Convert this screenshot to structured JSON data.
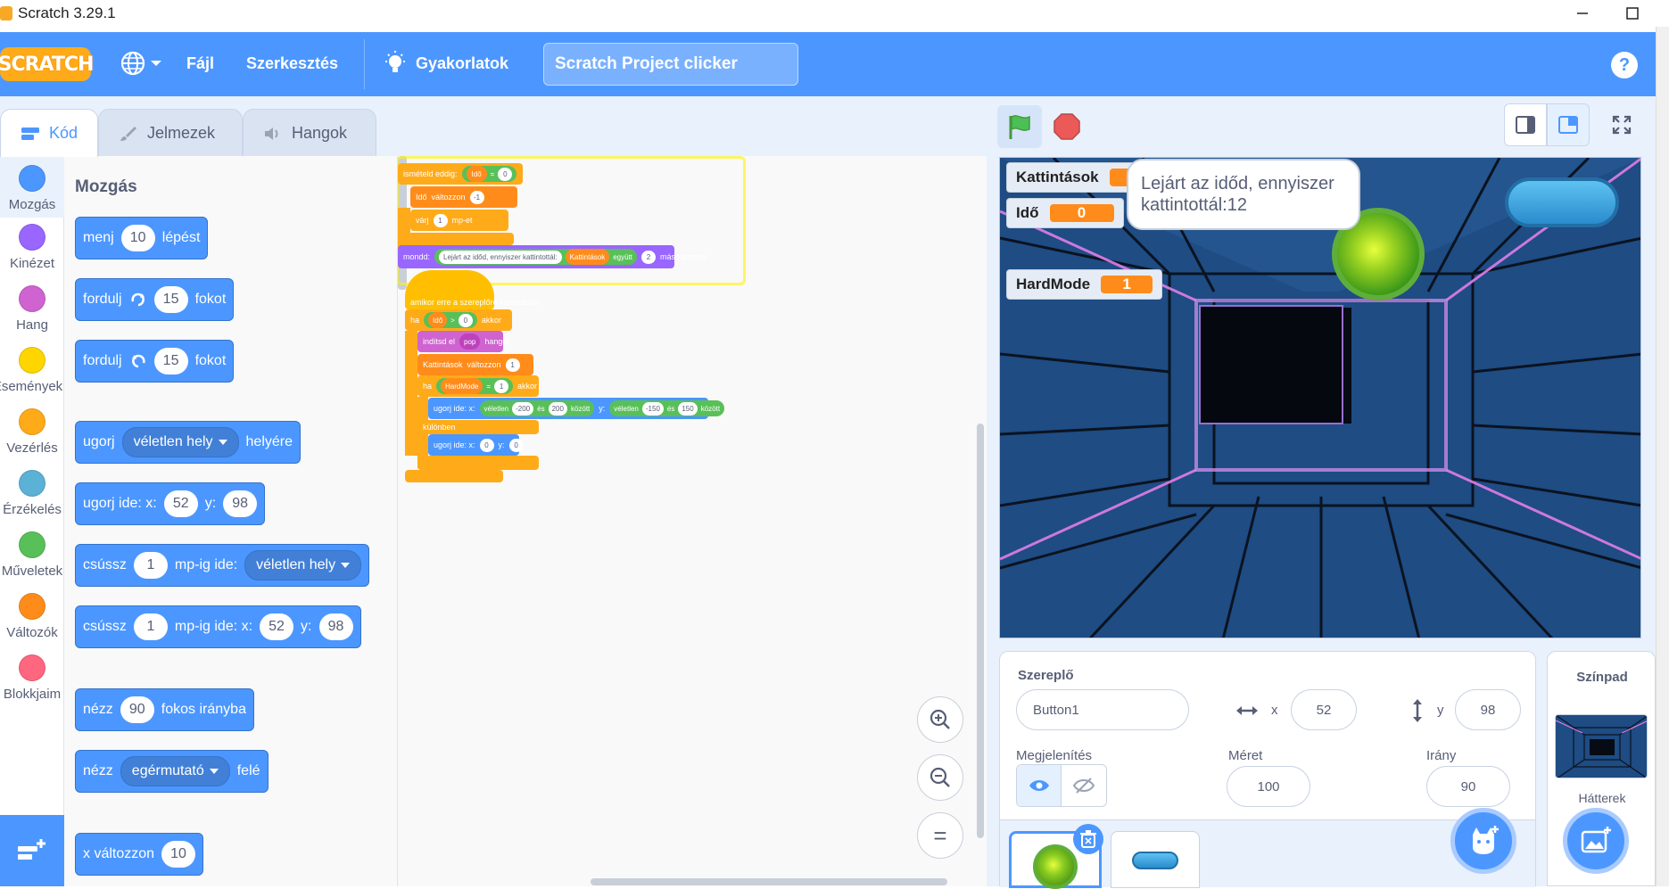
{
  "window": {
    "title": "Scratch 3.29.1",
    "minimize": "—",
    "maximize": "☐",
    "close": "✕"
  },
  "menubar": {
    "logo": "SCRATCH",
    "file": "Fájl",
    "edit": "Szerkesztés",
    "tutorials": "Gyakorlatok",
    "project_name": "Scratch Project clicker",
    "help": "?"
  },
  "tabs": {
    "code": "Kód",
    "costumes": "Jelmezek",
    "sounds": "Hangok"
  },
  "categories": [
    {
      "label": "Mozgás",
      "color": "#4c97ff"
    },
    {
      "label": "Kinézet",
      "color": "#9966ff"
    },
    {
      "label": "Hang",
      "color": "#cf63cf"
    },
    {
      "label": "Események",
      "color": "#ffd500"
    },
    {
      "label": "Vezérlés",
      "color": "#ffab19"
    },
    {
      "label": "Érzékelés",
      "color": "#5cb1d6"
    },
    {
      "label": "Műveletek",
      "color": "#59c059"
    },
    {
      "label": "Változók",
      "color": "#ff8c1a"
    },
    {
      "label": "Blokkjaim",
      "color": "#ff6680"
    }
  ],
  "palette": {
    "title": "Mozgás",
    "b1": {
      "a": "menj",
      "v": "10",
      "b": "lépést"
    },
    "b2": {
      "a": "fordulj",
      "v": "15",
      "b": "fokot"
    },
    "b3": {
      "a": "fordulj",
      "v": "15",
      "b": "fokot"
    },
    "b4": {
      "a": "ugorj",
      "d": "véletlen hely",
      "b": "helyére"
    },
    "b5": {
      "a": "ugorj ide: x:",
      "x": "52",
      "y_label": "y:",
      "y": "98"
    },
    "b6": {
      "a": "csússz",
      "v": "1",
      "b": "mp-ig ide:",
      "d": "véletlen hely"
    },
    "b7": {
      "a": "csússz",
      "v": "1",
      "b": "mp-ig ide: x:",
      "x": "52",
      "y_label": "y:",
      "y": "98"
    },
    "b8": {
      "a": "nézz",
      "v": "90",
      "b": "fokos irányba"
    },
    "b9": {
      "a": "nézz",
      "d": "egérmutató",
      "b": "felé"
    },
    "b10": {
      "a": "x változzon",
      "v": "10"
    }
  },
  "script": {
    "s1": {
      "a": "ismételd eddig:",
      "var": "Idő",
      "op": "=",
      "v": "0"
    },
    "s2": {
      "var": "Idő",
      "a": "változzon",
      "v": "-1"
    },
    "s3": {
      "a": "várj",
      "v": "1",
      "b": "mp-et"
    },
    "s4": {
      "a": "mondd:",
      "text": "Lejárt az időd, ennyiszer kattintottál:",
      "var": "Kattintások",
      "join": "együtt",
      "v": "2",
      "b": "másodpercig"
    },
    "h2": "amikor erre a szereplőre kattintáskor",
    "s5": {
      "a": "ha",
      "var": "Idő",
      "op": ">",
      "v": "0",
      "b": "akkor"
    },
    "s6": {
      "a": "indítsd el",
      "d": "pop",
      "b": "hangot"
    },
    "s7": {
      "var": "Kattintások",
      "a": "változzon",
      "v": "1"
    },
    "s8": {
      "a": "ha",
      "var": "HardMode",
      "op": "=",
      "v": "1",
      "b": "akkor"
    },
    "s9": {
      "a": "ugorj ide: x:",
      "r1": "véletlen",
      "x1": "-200",
      "and": "és",
      "x2": "200",
      "between": "között",
      "y_label": "y:",
      "r2": "véletlen",
      "y1": "-150",
      "y2": "150"
    },
    "else": "különben",
    "s10": {
      "a": "ugorj ide: x:",
      "x": "0",
      "y_label": "y:",
      "y": "0"
    }
  },
  "zoom": {
    "in": "+",
    "out": "−",
    "reset": "="
  },
  "stage": {
    "monitors": [
      {
        "name": "Kattintások",
        "value": "12"
      },
      {
        "name": "Idő",
        "value": "0"
      },
      {
        "name": "HardMode",
        "value": "1"
      }
    ],
    "bubble": "Lejárt az időd, ennyiszer kattintottál:12"
  },
  "sprite_info": {
    "sprite_label": "Szereplő",
    "sprite_name": "Button1",
    "x_label": "x",
    "x": "52",
    "y_label": "y",
    "y": "98",
    "show_label": "Megjelenítés",
    "size_label": "Méret",
    "size": "100",
    "direction_label": "Irány",
    "direction": "90"
  },
  "stage_panel": {
    "title": "Színpad",
    "backdrops_label": "Hátterek"
  }
}
